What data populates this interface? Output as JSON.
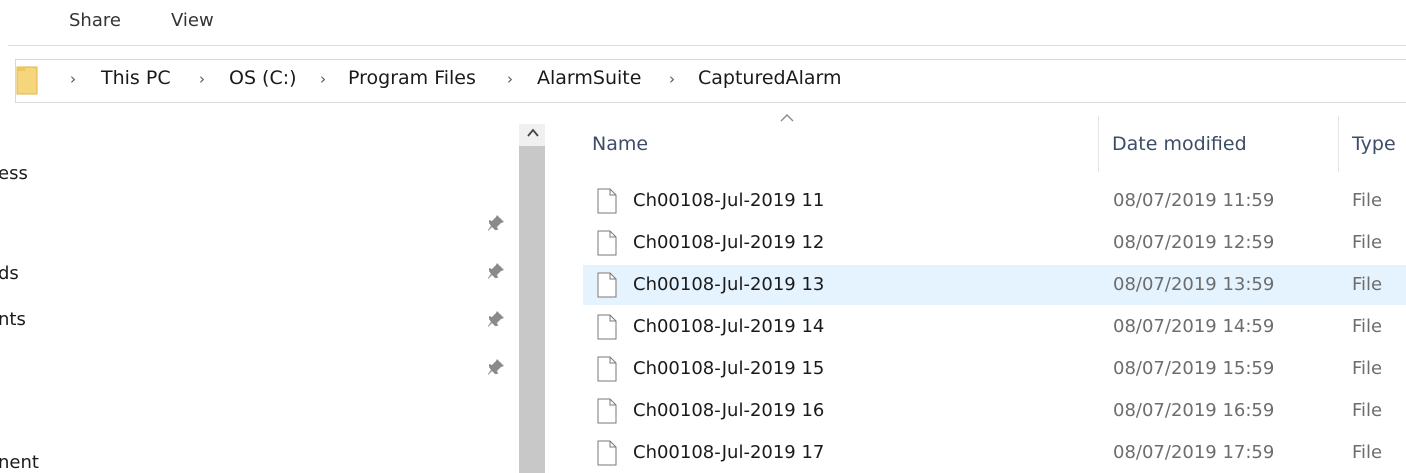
{
  "ribbon": {
    "tabs": [
      {
        "label": "Share"
      },
      {
        "label": "View"
      }
    ]
  },
  "address_bar": {
    "folder_icon": "folder-icon",
    "crumbs": [
      {
        "label": "This PC"
      },
      {
        "label": "OS (C:)"
      },
      {
        "label": "Program Files"
      },
      {
        "label": "AlarmSuite"
      },
      {
        "label": "CapturedAlarm"
      }
    ],
    "separator": "›"
  },
  "navigation": {
    "items": [
      {
        "label": "ess",
        "pinned": false
      },
      {
        "label": "",
        "pinned": true
      },
      {
        "label": "ds",
        "pinned": true
      },
      {
        "label": "nts",
        "pinned": true
      },
      {
        "label": "",
        "pinned": true
      },
      {
        "label": "nent",
        "pinned": false
      }
    ]
  },
  "file_list": {
    "columns": {
      "name": "Name",
      "date_modified": "Date modified",
      "type": "Type"
    },
    "sort_column": "name",
    "rows": [
      {
        "name": "Ch00108-Jul-2019 11",
        "date": "08/07/2019 11:59",
        "type": "File",
        "selected": false
      },
      {
        "name": "Ch00108-Jul-2019 12",
        "date": "08/07/2019 12:59",
        "type": "File",
        "selected": false
      },
      {
        "name": "Ch00108-Jul-2019 13",
        "date": "08/07/2019 13:59",
        "type": "File",
        "selected": true
      },
      {
        "name": "Ch00108-Jul-2019 14",
        "date": "08/07/2019 14:59",
        "type": "File",
        "selected": false
      },
      {
        "name": "Ch00108-Jul-2019 15",
        "date": "08/07/2019 15:59",
        "type": "File",
        "selected": false
      },
      {
        "name": "Ch00108-Jul-2019 16",
        "date": "08/07/2019 16:59",
        "type": "File",
        "selected": false
      },
      {
        "name": "Ch00108-Jul-2019 17",
        "date": "08/07/2019 17:59",
        "type": "File",
        "selected": false
      }
    ]
  },
  "colors": {
    "selection": "#e5f3ff",
    "header_text": "#3d4d66",
    "folder": "#f6d67a"
  }
}
